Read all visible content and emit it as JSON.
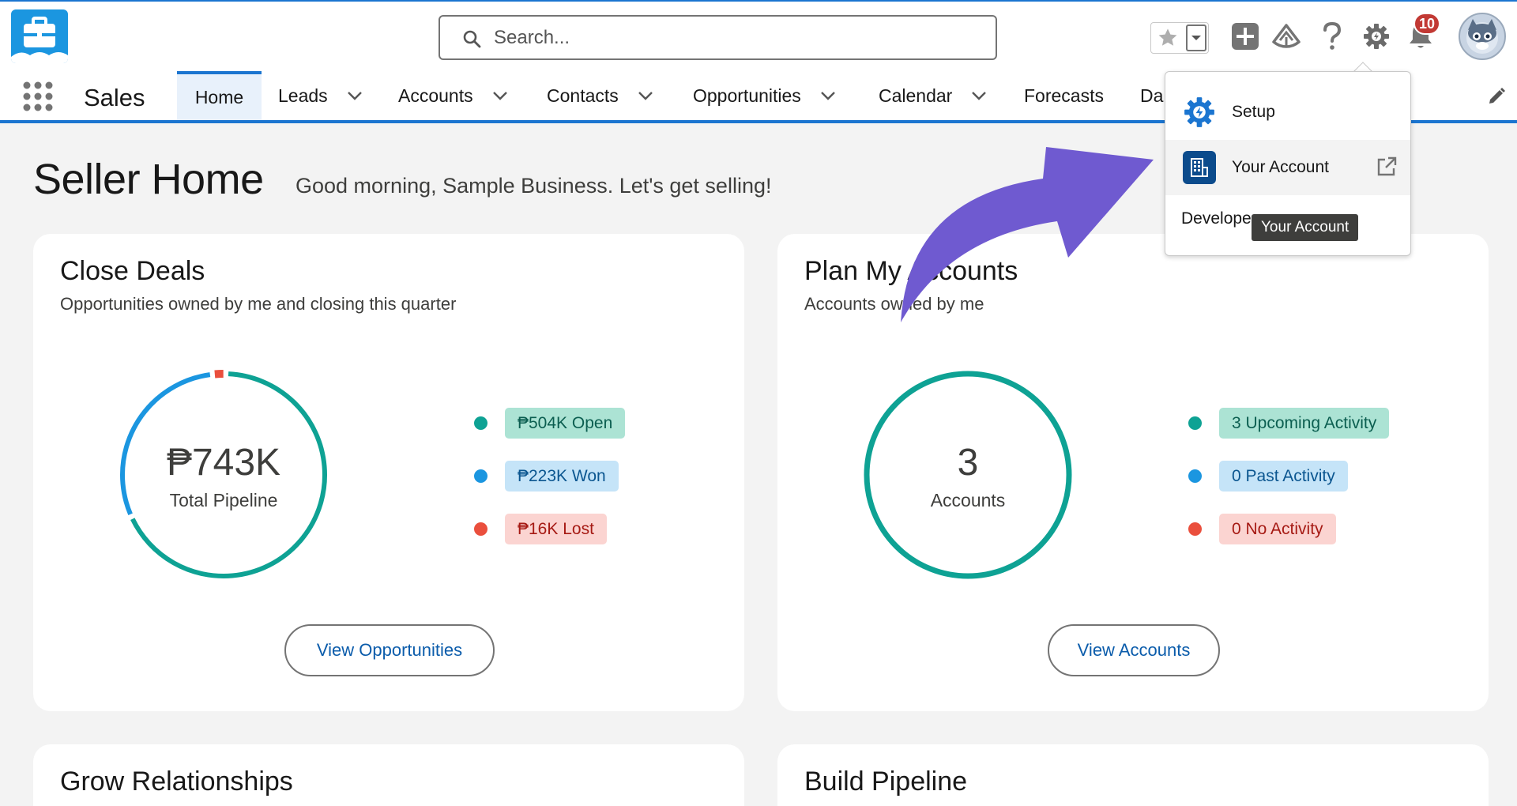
{
  "header": {
    "search_placeholder": "Search...",
    "notification_count": "10",
    "icons": [
      "briefcase-app-icon",
      "search-icon",
      "star-icon",
      "chevron-down-icon",
      "plus-icon",
      "trailhead-icon",
      "help-icon",
      "gear-icon",
      "bell-icon",
      "avatar"
    ]
  },
  "nav": {
    "app_name": "Sales",
    "tabs": [
      {
        "label": "Home"
      },
      {
        "label": "Leads"
      },
      {
        "label": "Accounts"
      },
      {
        "label": "Contacts"
      },
      {
        "label": "Opportunities"
      },
      {
        "label": "Calendar"
      },
      {
        "label": "Forecasts"
      },
      {
        "label": "Da"
      }
    ]
  },
  "page": {
    "title": "Seller Home",
    "greeting": "Good morning, Sample Business. Let's get selling!"
  },
  "close_deals": {
    "title": "Close Deals",
    "subtitle": "Opportunities owned by me and closing this quarter",
    "total_value": "₱743K",
    "total_label": "Total Pipeline",
    "legend": [
      {
        "label": "₱504K Open",
        "color": "#0ea294"
      },
      {
        "label": "₱223K Won",
        "color": "#1b96e0"
      },
      {
        "label": "₱16K Lost",
        "color": "#ea4f3d"
      }
    ],
    "ring_shares": {
      "open": 0.6784,
      "won": 0.3001,
      "lost": 0.0215
    },
    "button": "View Opportunities"
  },
  "plan_accounts": {
    "title": "Plan My Accounts",
    "subtitle": "Accounts owned by me",
    "total_value": "3",
    "total_label": "Accounts",
    "legend": [
      {
        "label": "3 Upcoming Activity",
        "color": "#0ea294"
      },
      {
        "label": "0 Past Activity",
        "color": "#1b96e0"
      },
      {
        "label": "0 No Activity",
        "color": "#ea4f3d"
      }
    ],
    "button": "View Accounts"
  },
  "lower_cards": {
    "left_title": "Grow Relationships",
    "right_title": "Build Pipeline"
  },
  "setup_menu": {
    "items": [
      {
        "label": "Setup"
      },
      {
        "label": "Your Account"
      },
      {
        "label": "Develope"
      }
    ],
    "tooltip": "Your Account"
  },
  "colors": {
    "brand_blue": "#1b75d0",
    "teal": "#0ea294",
    "arrow_purple": "#6f5ad0"
  }
}
